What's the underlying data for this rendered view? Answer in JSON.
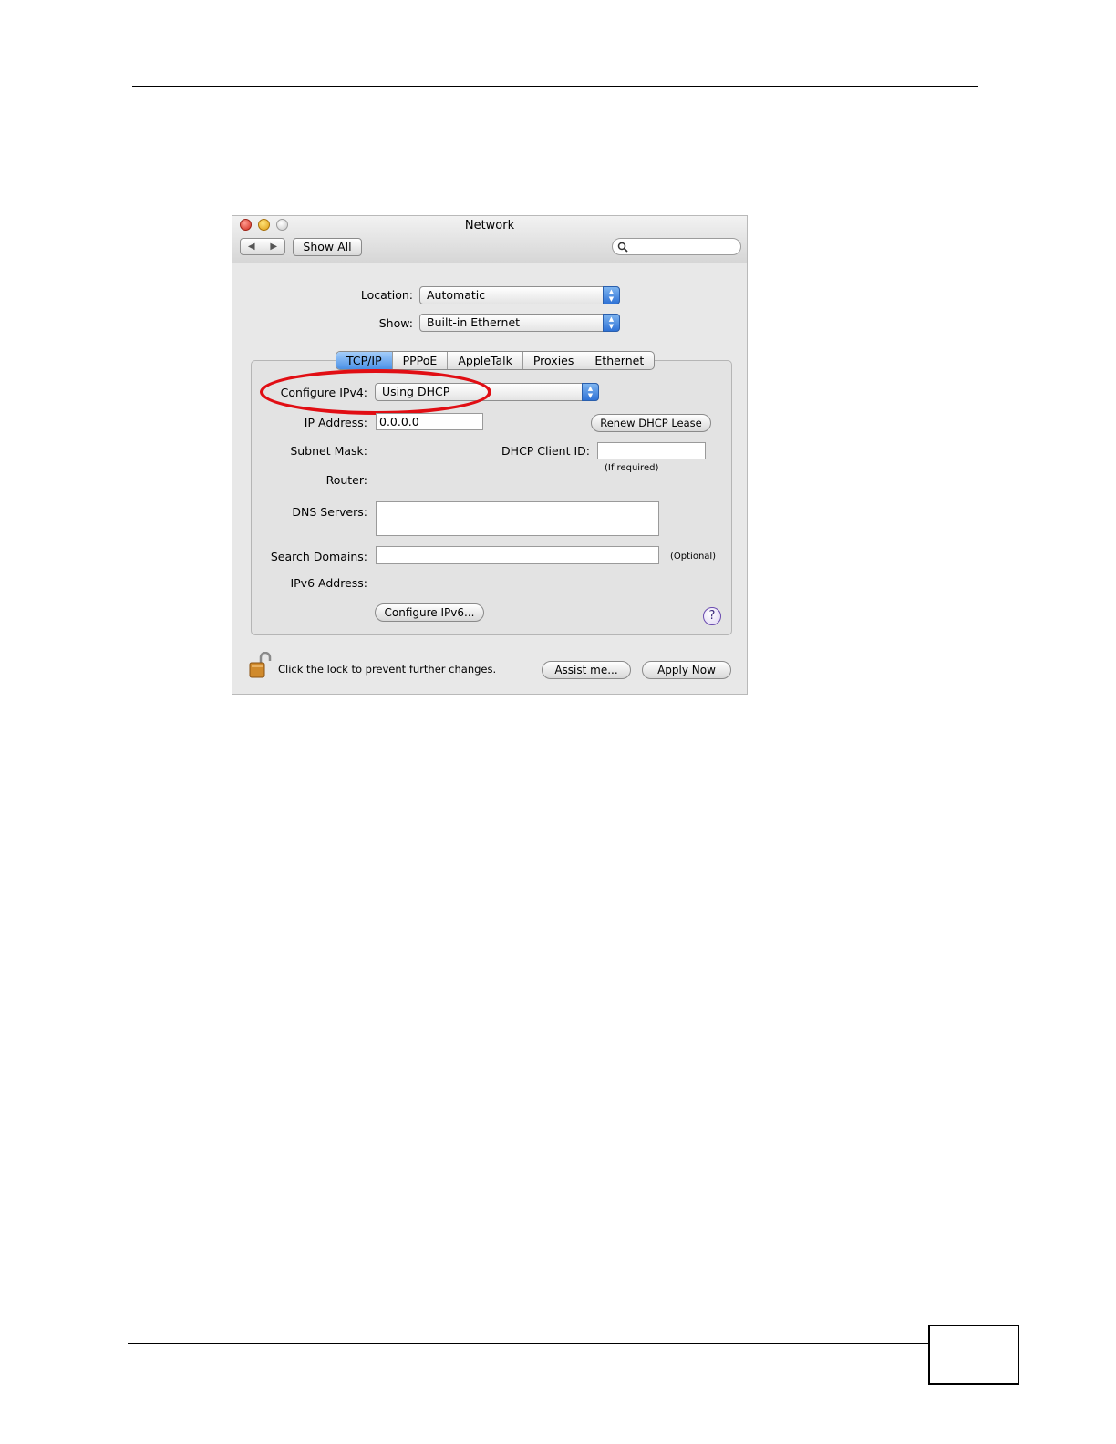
{
  "window": {
    "title": "Network",
    "nav_back": "◀",
    "nav_forward": "▶",
    "show_all": "Show All",
    "search_placeholder": ""
  },
  "location": {
    "label": "Location:",
    "value": "Automatic"
  },
  "show": {
    "label": "Show:",
    "value": "Built-in Ethernet"
  },
  "tabs": [
    "TCP/IP",
    "PPPoE",
    "AppleTalk",
    "Proxies",
    "Ethernet"
  ],
  "active_tab": "TCP/IP",
  "tcpip": {
    "configure_ipv4_label": "Configure IPv4:",
    "configure_ipv4_value": "Using DHCP",
    "ip_address_label": "IP Address:",
    "ip_address_value": "0.0.0.0",
    "renew_button": "Renew DHCP Lease",
    "subnet_mask_label": "Subnet Mask:",
    "dhcp_client_id_label": "DHCP Client ID:",
    "dhcp_client_id_value": "",
    "if_required": "(If required)",
    "router_label": "Router:",
    "dns_label": "DNS Servers:",
    "dns_value": "",
    "search_domains_label": "Search Domains:",
    "search_domains_value": "",
    "optional": "(Optional)",
    "ipv6_label": "IPv6 Address:",
    "configure_ipv6_button": "Configure IPv6...",
    "help": "?"
  },
  "footer": {
    "lock_text": "Click the lock to prevent further changes.",
    "assist_button": "Assist me...",
    "apply_button": "Apply Now"
  },
  "colors": {
    "highlight_ellipse": "#e10e14",
    "active_tab": "#4a90e6"
  }
}
